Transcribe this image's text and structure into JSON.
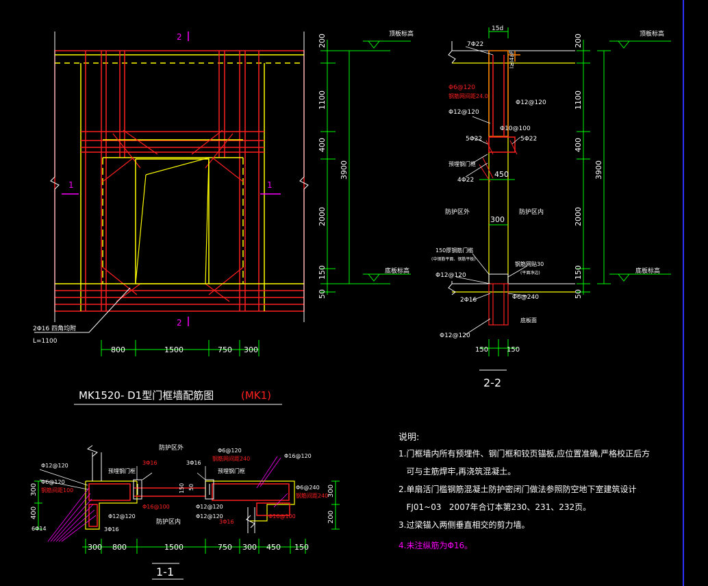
{
  "elevation": {
    "section_mark_top": "2",
    "section_mark_bottom": "2",
    "section_mark_left": "1",
    "section_mark_right": "1",
    "rebar_callout": "2Φ16 四角均附",
    "rebar_length": "L=1100",
    "dim_bottom": [
      "800",
      "1500",
      "750",
      "300"
    ],
    "dim_right": [
      "200",
      "1100",
      "400",
      "2000",
      "150",
      "50"
    ],
    "dim_total": "3900",
    "label_top_level": "顶板标高",
    "label_bottom_level": "底板标高"
  },
  "title_main": "MK1520- D1型门框墙配筋图",
  "title_tag": "(MK1)",
  "section22": {
    "title": "2-2",
    "top_dim": "15d",
    "bar_top": "7Φ22",
    "side_note": "l≥l4aF",
    "lbl1": "Φ6@120",
    "lbl2": "钢筋网间距24.0",
    "lbl3": "Φ12@120",
    "lbl4": "Φ12@120",
    "lbl5": "Φ10@100",
    "lbl6": "5Φ22",
    "lbl7": "5Φ22",
    "lbl8": "预埋钢门框",
    "lbl9": "4Φ22",
    "dim450": "450",
    "zone_out": "防护区外",
    "zone_in": "防护区内",
    "dim300": "300",
    "lbl10": "150厚钢筋门槛",
    "lbl10b": "(中钢筋平面、钢筋平板)",
    "lbl11": "钢筋网贴30",
    "lbl11b": "(平面净边)",
    "lbl12": "Φ12@120",
    "lbl13": "2Φ16",
    "lbl14": "Φ6@240",
    "lbl15": "底板面",
    "lbl16": "Φ12@120",
    "dim_bottom": [
      "150",
      "150"
    ],
    "dim_right": [
      "200",
      "1100",
      "400",
      "2000",
      "150",
      "50"
    ],
    "dim_total": "3900",
    "label_top_level": "顶板标高",
    "label_bottom_level": "底板标高"
  },
  "section11": {
    "title": "1-1",
    "zone_top": "防护区外",
    "zone_bottom": "防护区内",
    "labels": [
      "Φ12@120",
      "Φ6@120",
      "钢筋间距100",
      "6Φ14",
      "3Φ16",
      "预埋钢门框",
      "3Φ16",
      "Φ16@100",
      "Φ12@120",
      "3Φ16",
      "Φ6@120",
      "钢筋网间距240",
      "预埋钢门框",
      "Φ16@120",
      "Φ12@120",
      "Φ12@120",
      "Φ6@240",
      "钢筋间距240",
      "Φ16@100",
      "3Φ16",
      "150",
      "50"
    ],
    "dim_bottom": [
      "300",
      "800",
      "1500",
      "750",
      "300",
      "450",
      "150"
    ],
    "dim_left": [
      "300",
      "400"
    ],
    "dim_right": [
      "300",
      "200"
    ]
  },
  "notes": {
    "title": "说明:",
    "lines": [
      "1.门框墙内所有预埋件、钢门框和铰页锚板,应位置准确,严格校正后方",
      "   可与主筋焊牢,再浇筑混凝土。",
      "2.单扇活门槛钢筋混凝土防护密闭门做法参照防空地下室建筑设计",
      "   FJ01~03   2007年合订本第230、231、232页。",
      "3.过梁锚入两侧垂直相交的剪力墙。",
      "4.未注纵筋为Φ16。"
    ]
  },
  "colors": {
    "background": "#000000",
    "white": "#ffffff",
    "red": "#ff2020",
    "yellow": "#ffff00",
    "green": "#00ff00",
    "magenta": "#ff00ff",
    "orange": "#ff8000",
    "blue": "#3030ff"
  }
}
